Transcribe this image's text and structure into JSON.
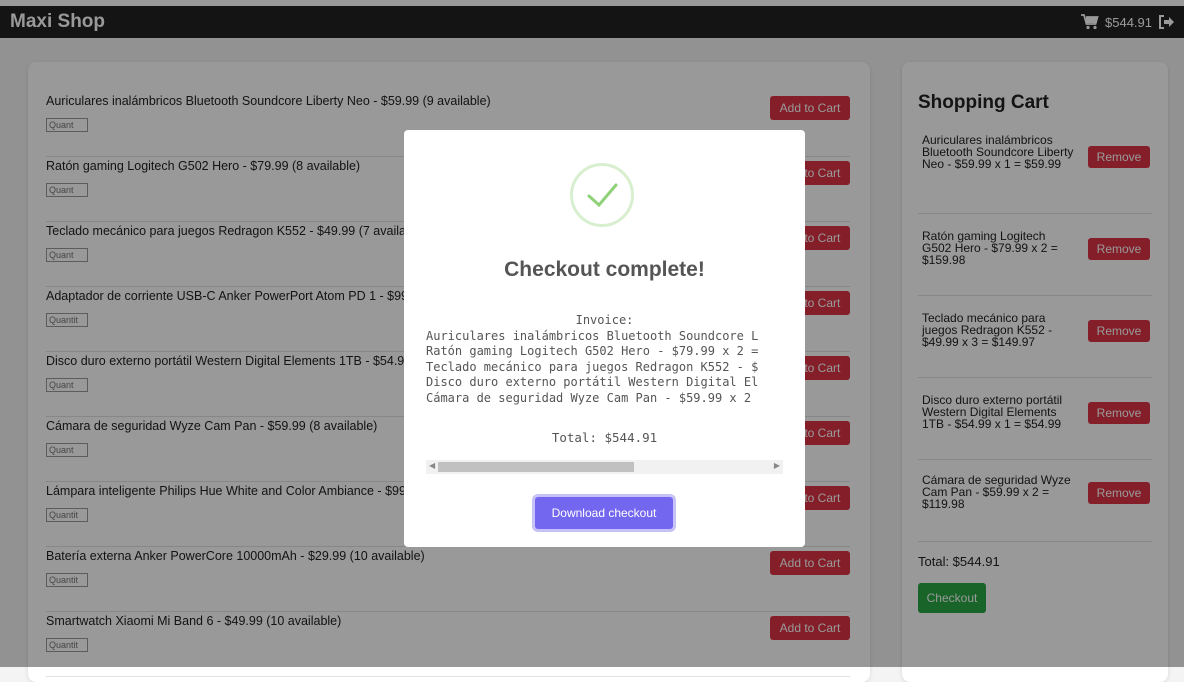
{
  "header": {
    "brand": "Maxi Shop",
    "cart_total": "$544.91",
    "cart_icon": "shopping-cart-icon",
    "logout_icon": "sign-out-icon"
  },
  "products": [
    {
      "title": "Auriculares inalámbricos Bluetooth Soundcore Liberty Neo - $59.99 (9 available)",
      "qty_placeholder": "Quant",
      "button": "Add to Cart"
    },
    {
      "title": "Ratón gaming Logitech G502 Hero - $79.99 (8 available)",
      "qty_placeholder": "Quant",
      "button": "Add to Cart"
    },
    {
      "title": "Teclado mecánico para juegos Redragon K552 - $49.99 (7 available)",
      "qty_placeholder": "Quant",
      "button": "Add to Cart"
    },
    {
      "title": "Adaptador de corriente USB-C Anker PowerPort Atom PD 1 - $99.99",
      "qty_placeholder": "Quantit",
      "button": "Add to Cart"
    },
    {
      "title": "Disco duro externo portátil Western Digital Elements 1TB - $54.99",
      "qty_placeholder": "Quant",
      "button": "Add to Cart"
    },
    {
      "title": "Cámara de seguridad Wyze Cam Pan - $59.99 (8 available)",
      "qty_placeholder": "Quant",
      "button": "Add to Cart"
    },
    {
      "title": "Lámpara inteligente Philips Hue White and Color Ambiance - $99.99",
      "qty_placeholder": "Quantit",
      "button": "Add to Cart"
    },
    {
      "title": "Batería externa Anker PowerCore 10000mAh - $29.99 (10 available)",
      "qty_placeholder": "Quantit",
      "button": "Add to Cart"
    },
    {
      "title": "Smartwatch Xiaomi Mi Band 6 - $49.99 (10 available)",
      "qty_placeholder": "Quantit",
      "button": "Add to Cart"
    }
  ],
  "cart": {
    "title": "Shopping Cart",
    "items": [
      {
        "text": "Auriculares inalámbricos Bluetooth Soundcore Liberty Neo - $59.99 x 1 = $59.99",
        "button": "Remove"
      },
      {
        "text": "Ratón gaming Logitech G502 Hero - $79.99 x 2 = $159.98",
        "button": "Remove"
      },
      {
        "text": "Teclado mecánico para juegos Redragon K552 - $49.99 x 3 = $149.97",
        "button": "Remove"
      },
      {
        "text": "Disco duro externo portátil Western Digital Elements 1TB - $54.99 x 1 = $54.99",
        "button": "Remove"
      },
      {
        "text": "Cámara de seguridad Wyze Cam Pan - $59.99 x 2 = $119.98",
        "button": "Remove"
      }
    ],
    "total": "Total: $544.91",
    "checkout": "Checkout"
  },
  "modal": {
    "title": "Checkout complete!",
    "invoice_heading": "Invoice:",
    "invoice_lines": [
      "Auriculares inalámbricos Bluetooth Soundcore L",
      "Ratón gaming Logitech G502 Hero - $79.99 x 2 =",
      "Teclado mecánico para juegos Redragon K552 - $",
      "Disco duro externo portátil Western Digital El",
      "Cámara de seguridad Wyze Cam Pan - $59.99 x 2"
    ],
    "total": "Total: $544.91",
    "download": "Download checkout",
    "success_icon": "check-icon"
  },
  "colors": {
    "danger": "#dc3545",
    "success": "#28a745",
    "primary": "#7367f0",
    "topbar": "#222222"
  }
}
